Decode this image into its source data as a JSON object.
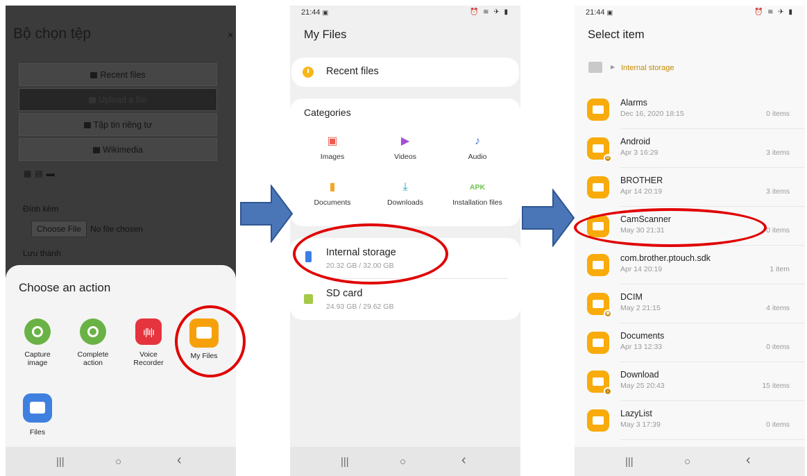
{
  "screen1": {
    "title": "Bộ chọn tệp",
    "close": "×",
    "menu": [
      "Recent files",
      "Upload a file",
      "Tập tin riêng tư",
      "Wikimedia"
    ],
    "attach_label": "Đính kèm",
    "choose_file": "Choose File",
    "no_file": "No file chosen",
    "save_as_label": "Lưu thành",
    "sheet_title": "Choose an action",
    "apps": [
      {
        "label": "Capture\nimage",
        "icon": "camera-gear-icon",
        "color": "#6ab245"
      },
      {
        "label": "Complete\naction",
        "icon": "camera-gear-icon",
        "color": "#6ab245"
      },
      {
        "label": "Voice\nRecorder",
        "icon": "waveform-icon",
        "color": "#e5343d"
      },
      {
        "label": "My Files",
        "icon": "folder-icon",
        "color": "#f6a10c"
      },
      {
        "label": "Files",
        "icon": "folder-icon",
        "color": "#3f7fe0"
      }
    ]
  },
  "status": {
    "time": "21:44",
    "icons": "⏰ ≋ ✈ ▮"
  },
  "nav": {
    "recents": "|||",
    "home": "○",
    "back": "‹"
  },
  "screen2": {
    "title": "My Files",
    "recent": "Recent files",
    "categories_title": "Categories",
    "categories": [
      {
        "label": "Images",
        "glyph": "▣",
        "color": "#ef5b4f"
      },
      {
        "label": "Videos",
        "glyph": "▶",
        "color": "#a34fd6"
      },
      {
        "label": "Audio",
        "glyph": "♪",
        "color": "#3c7ee8"
      },
      {
        "label": "Documents",
        "glyph": "▮",
        "color": "#f6a623"
      },
      {
        "label": "Downloads",
        "glyph": "⤓",
        "color": "#21a8c4"
      },
      {
        "label": "Installation files",
        "glyph": "APK",
        "color": "#6dc24b"
      }
    ],
    "storage": [
      {
        "name": "Internal storage",
        "size": "20.32 GB / 32.00 GB",
        "color": "#3c7ee8"
      },
      {
        "name": "SD card",
        "size": "24.93 GB / 29.62 GB",
        "color": "#a6c94a"
      }
    ]
  },
  "screen3": {
    "title": "Select item",
    "breadcrumb": "Internal storage",
    "folders": [
      {
        "name": "Alarms",
        "date": "Dec 16, 2020 18:15",
        "count": "0 items",
        "badge": ""
      },
      {
        "name": "Android",
        "date": "Apr 3 16:29",
        "count": "3 items",
        "badge": "⚙"
      },
      {
        "name": "BROTHER",
        "date": "Apr 14 20:19",
        "count": "3 items",
        "badge": ""
      },
      {
        "name": "CamScanner",
        "date": "May 30 21:31",
        "count": "0 items",
        "badge": ""
      },
      {
        "name": "com.brother.ptouch.sdk",
        "date": "Apr 14 20:19",
        "count": "1 item",
        "badge": ""
      },
      {
        "name": "DCIM",
        "date": "May 2 21:15",
        "count": "4 items",
        "badge": "◉"
      },
      {
        "name": "Documents",
        "date": "Apr 13 12:33",
        "count": "0 items",
        "badge": ""
      },
      {
        "name": "Download",
        "date": "May 25 20:43",
        "count": "15 items",
        "badge": "↓"
      },
      {
        "name": "LazyList",
        "date": "May 3 17:39",
        "count": "0 items",
        "badge": ""
      }
    ]
  },
  "colors": {
    "arrow": "#4a76b8",
    "highlight": "#e00000",
    "folder": "#f8ab0a"
  }
}
